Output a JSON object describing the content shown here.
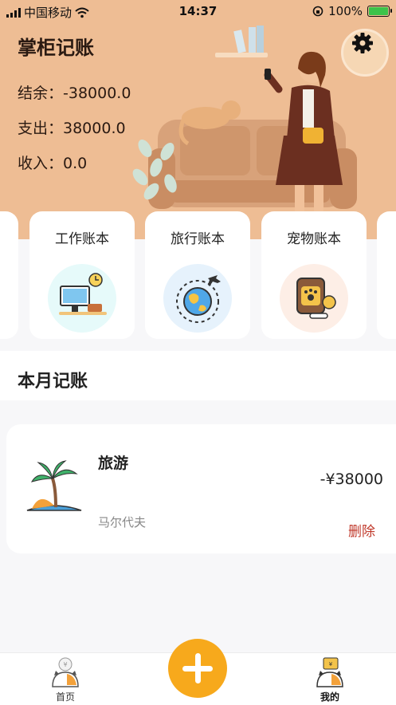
{
  "status_bar": {
    "carrier": "中国移动",
    "time": "14:37",
    "battery": "100%",
    "battery_level": 1.0
  },
  "header": {
    "title": "掌柜记账",
    "balance": "结余：-38000.0",
    "expense": "支出：38000.0",
    "income": "收入：0.0",
    "settings_icon": "gear-icon"
  },
  "books": [
    {
      "label": "工作账本",
      "icon": "computer-desk-icon",
      "bg": "#e6fafa"
    },
    {
      "label": "旅行账本",
      "icon": "globe-plane-icon",
      "bg": "#e6f2fc"
    },
    {
      "label": "宠物账本",
      "icon": "pet-food-icon",
      "bg": "#fdeee6"
    }
  ],
  "section": {
    "title": "本月记账"
  },
  "records": [
    {
      "name": "旅游",
      "place": "马尔代夫",
      "amount": "-¥38000",
      "delete": "删除",
      "icon": "palm-island-icon"
    }
  ],
  "tabbar": {
    "home": "首页",
    "mine": "我的",
    "add_icon": "plus-icon"
  },
  "colors": {
    "hero": "#eebd94",
    "accent": "#f7a91c",
    "delete": "#c0392b"
  }
}
